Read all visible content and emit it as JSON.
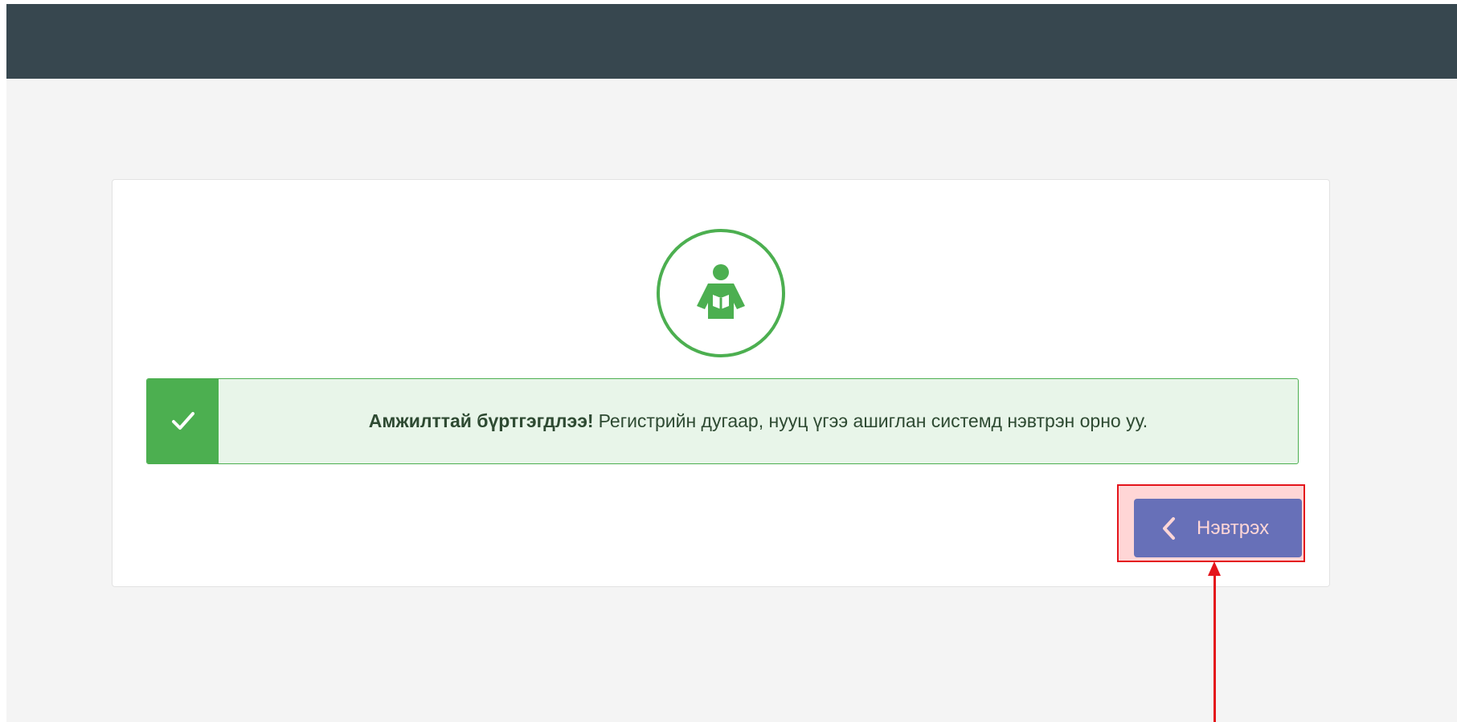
{
  "header": {},
  "card": {
    "logo_icon": "reader-book-icon",
    "alert": {
      "icon": "check-icon",
      "bold_text": "Амжилттай бүртгэгдлээ!",
      "message": "Регистрийн дугаар, нууц үгээ ашиглан системд нэвтрэн орно уу."
    },
    "login_button": {
      "icon": "chevron-left-icon",
      "label": "Нэвтрэх"
    }
  },
  "colors": {
    "topbar": "#37474f",
    "background": "#f4f4f4",
    "success": "#4caf50",
    "alert_background": "#e8f5e9",
    "button": "#4a86dc",
    "annotation": "#e4141b"
  }
}
